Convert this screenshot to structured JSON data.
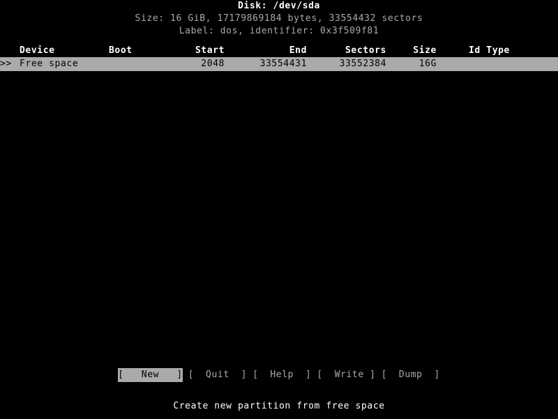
{
  "app": {
    "name": "cfdisk"
  },
  "disk": {
    "title": "Disk: /dev/sda",
    "size_line": "Size: 16 GiB, 17179869184 bytes, 33554432 sectors",
    "label_line": "Label: dos, identifier: 0x3f509f81"
  },
  "table": {
    "columns": [
      {
        "key": "device",
        "label": "Device",
        "align": "left"
      },
      {
        "key": "boot",
        "label": "Boot",
        "align": "left"
      },
      {
        "key": "start",
        "label": "Start",
        "align": "right"
      },
      {
        "key": "end",
        "label": "End",
        "align": "right"
      },
      {
        "key": "sectors",
        "label": "Sectors",
        "align": "right"
      },
      {
        "key": "size",
        "label": "Size",
        "align": "right"
      },
      {
        "key": "idtype",
        "label": "Id Type",
        "align": "left"
      }
    ],
    "rows": [
      {
        "marker": ">>",
        "device": "Free space",
        "boot": "",
        "start": "2048",
        "end": "33554431",
        "sectors": "33552384",
        "size": "16G",
        "idtype": "",
        "selected": true
      }
    ]
  },
  "menu": {
    "buttons": [
      {
        "label": "[   New   ]",
        "name": "new",
        "selected": true
      },
      {
        "label": "[  Quit  ]",
        "name": "quit",
        "selected": false
      },
      {
        "label": "[  Help  ]",
        "name": "help",
        "selected": false
      },
      {
        "label": "[  Write ]",
        "name": "write",
        "selected": false
      },
      {
        "label": "[  Dump  ]",
        "name": "dump",
        "selected": false
      }
    ]
  },
  "status": {
    "hint": "Create new partition from free space"
  },
  "colors": {
    "background": "#000000",
    "text": "#aaaaaa",
    "bright_text": "#ffffff",
    "highlight_bg": "#aaaaaa",
    "highlight_fg": "#000000"
  }
}
